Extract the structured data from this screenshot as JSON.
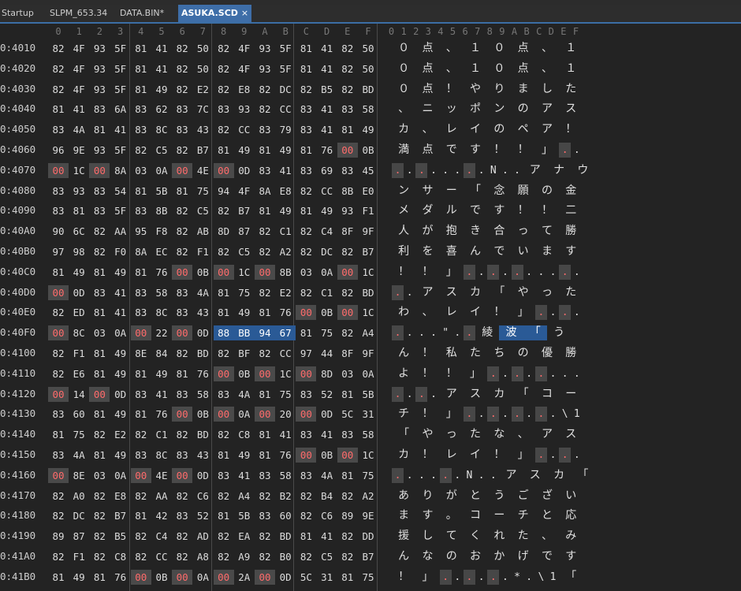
{
  "tabs": [
    {
      "label": "Startup",
      "active": false
    },
    {
      "label": "SLPM_653.34",
      "active": false
    },
    {
      "label": "DATA.BIN*",
      "active": false
    },
    {
      "label": "ASUKA.SCD",
      "active": true,
      "close": "×"
    }
  ],
  "header": {
    "hex_cols": [
      "0",
      "1",
      "2",
      "3",
      "4",
      "5",
      "6",
      "7",
      "8",
      "9",
      "A",
      "B",
      "C",
      "D",
      "E",
      "F"
    ],
    "ascii_cols": [
      "0",
      "1",
      "2",
      "3",
      "4",
      "5",
      "6",
      "7",
      "8",
      "9",
      "A",
      "B",
      "C",
      "D",
      "E",
      "F"
    ]
  },
  "selection": {
    "row": 14,
    "bytes": [
      8,
      9,
      10,
      11
    ]
  },
  "rows": [
    {
      "address": "0:4010",
      "hex": "82 4F 93 5F 81 41 82 50 82 4F 93 5F 81 41 82 50",
      "text": "０点、１０点、１"
    },
    {
      "address": "0:4020",
      "hex": "82 4F 93 5F 81 41 82 50 82 4F 93 5F 81 41 82 50",
      "text": "０点、１０点、１"
    },
    {
      "address": "0:4030",
      "hex": "82 4F 93 5F 81 49 82 E2 82 E8 82 DC 82 B5 82 BD",
      "text": "０点！やりました"
    },
    {
      "address": "0:4040",
      "hex": "81 41 83 6A 83 62 83 7C 83 93 82 CC 83 41 83 58",
      "text": "、ニッポンのアス"
    },
    {
      "address": "0:4050",
      "hex": "83 4A 81 41 83 8C 83 43 82 CC 83 79 83 41 81 49",
      "text": "カ、レイのペア！"
    },
    {
      "address": "0:4060",
      "hex": "96 9E 93 5F 82 C5 82 B7 81 49 81 49 81 76 00 0B",
      "text": "満点です！！」.."
    },
    {
      "address": "0:4070",
      "hex": "00 1C 00 8A 03 0A 00 4E 00 0D 83 41 83 69 83 45",
      "text": "........N..アナウ"
    },
    {
      "address": "0:4080",
      "hex": "83 93 83 54 81 5B 81 75 94 4F 8A E8 82 CC 8B E0",
      "text": "ンサー「念願の金"
    },
    {
      "address": "0:4090",
      "hex": "83 81 83 5F 83 8B 82 C5 82 B7 81 49 81 49 93 F1",
      "text": "メダルです！！二"
    },
    {
      "address": "0:40A0",
      "hex": "90 6C 82 AA 95 F8 82 AB 8D 87 82 C1 82 C4 8F 9F",
      "text": "人が抱き合って勝"
    },
    {
      "address": "0:40B0",
      "hex": "97 98 82 F0 8A EC 82 F1 82 C5 82 A2 82 DC 82 B7",
      "text": "利を喜んでいます"
    },
    {
      "address": "0:40C0",
      "hex": "81 49 81 49 81 76 00 0B 00 1C 00 8B 03 0A 00 1C",
      "text": "！！」.........."
    },
    {
      "address": "0:40D0",
      "hex": "00 0D 83 41 83 58 83 4A 81 75 82 E2 82 C1 82 BD",
      "text": "..アスカ「やった"
    },
    {
      "address": "0:40E0",
      "hex": "82 ED 81 41 83 8C 83 43 81 49 81 76 00 0B 00 1C",
      "text": "わ、レイ！」...."
    },
    {
      "address": "0:40F0",
      "hex": "00 8C 03 0A 00 22 00 0D 88 BB 94 67 81 75 82 A4",
      "text": "....\"..綾波「う"
    },
    {
      "address": "0:4100",
      "hex": "82 F1 81 49 8E 84 82 BD 82 BF 82 CC 97 44 8F 9F",
      "text": "ん！私たちの優勝"
    },
    {
      "address": "0:4110",
      "hex": "82 E6 81 49 81 49 81 76 00 0B 00 1C 00 8D 03 0A",
      "text": "よ！！」........"
    },
    {
      "address": "0:4120",
      "hex": "00 14 00 0D 83 41 83 58 83 4A 81 75 83 52 81 5B",
      "text": "....アスカ「コー"
    },
    {
      "address": "0:4130",
      "hex": "83 60 81 49 81 76 00 0B 00 0A 00 20 00 0D 5C 31",
      "text": "チ！」........\\1"
    },
    {
      "address": "0:4140",
      "hex": "81 75 82 E2 82 C1 82 BD 82 C8 81 41 83 41 83 58",
      "text": "「やったな、アス"
    },
    {
      "address": "0:4150",
      "hex": "83 4A 81 49 83 8C 83 43 81 49 81 76 00 0B 00 1C",
      "text": "カ！レイ！」...."
    },
    {
      "address": "0:4160",
      "hex": "00 8E 03 0A 00 4E 00 0D 83 41 83 58 83 4A 81 75",
      "text": "......N..アスカ「"
    },
    {
      "address": "0:4170",
      "hex": "82 A0 82 E8 82 AA 82 C6 82 A4 82 B2 82 B4 82 A2",
      "text": "ありがとうござい"
    },
    {
      "address": "0:4180",
      "hex": "82 DC 82 B7 81 42 83 52 81 5B 83 60 82 C6 89 9E",
      "text": "ます。コーチと応"
    },
    {
      "address": "0:4190",
      "hex": "89 87 82 B5 82 C4 82 AD 82 EA 82 BD 81 41 82 DD",
      "text": "援してくれた、み"
    },
    {
      "address": "0:41A0",
      "hex": "82 F1 82 C8 82 CC 82 A8 82 A9 82 B0 82 C5 82 B7",
      "text": "んなのおかげです"
    },
    {
      "address": "0:41B0",
      "hex": "81 49 81 76 00 0B 00 0A 00 2A 00 0D 5C 31 81 75",
      "text": "！」......*.\\1「"
    }
  ]
}
